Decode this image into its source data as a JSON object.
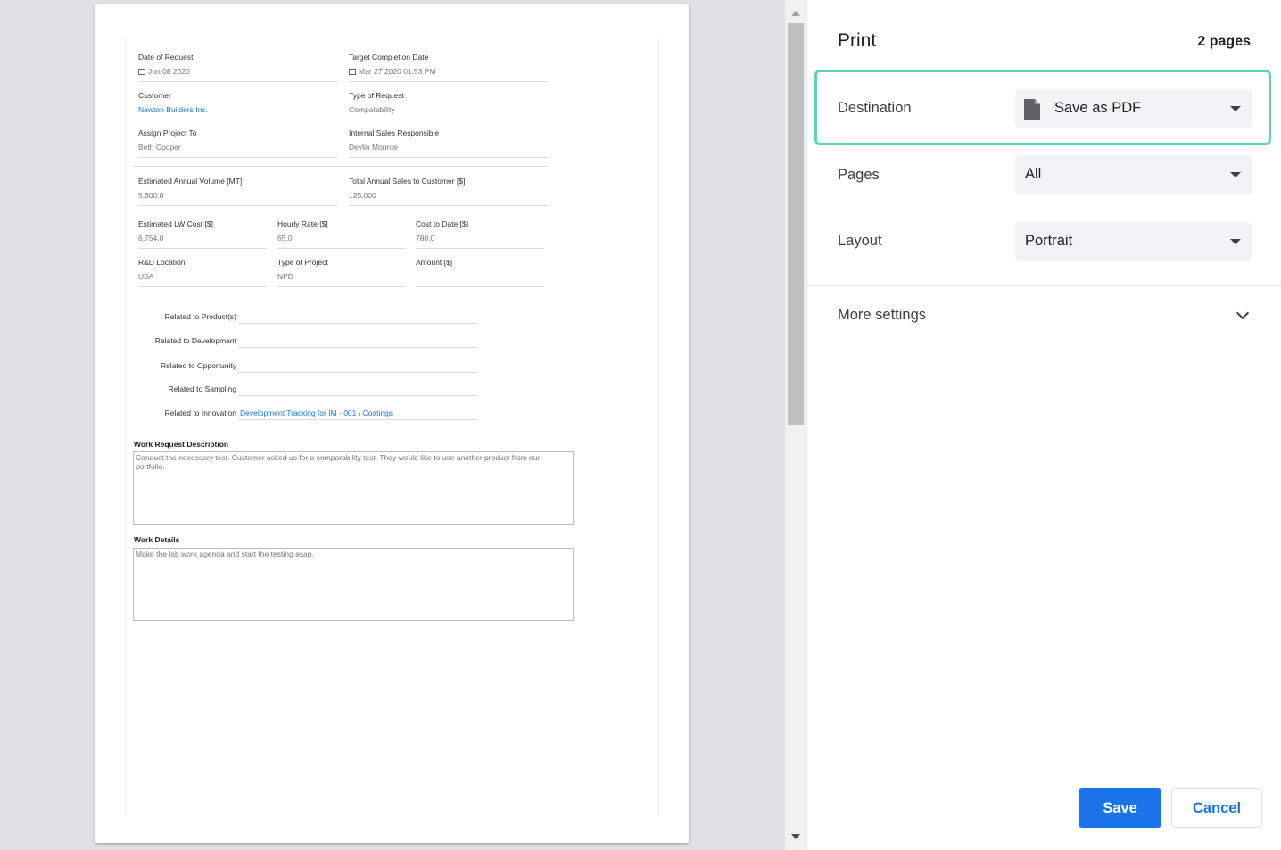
{
  "document": {
    "fields": {
      "date_of_request": {
        "label": "Date of Request",
        "value": "Jun 08 2020"
      },
      "target_completion": {
        "label": "Target Completion Date",
        "value": "Mar 27 2020 01:53 PM"
      },
      "customer": {
        "label": "Customer",
        "value": "Newton Builders Inc."
      },
      "type_of_request": {
        "label": "Type of Request",
        "value": "Compatability"
      },
      "assign_project_to": {
        "label": "Assign Project To",
        "value": "Beth Cooper"
      },
      "internal_sales": {
        "label": "Internal Sales Responsible",
        "value": "Devlin Monroe"
      },
      "est_annual_volume": {
        "label": "Estimated Annual Volume [MT]",
        "value": "5,600.0"
      },
      "total_annual_sales": {
        "label": "Total Annual Sales to Customer [$]",
        "value": "125,000"
      },
      "est_lw_cost": {
        "label": "Estimated LW Cost [$]",
        "value": "6,754.0"
      },
      "hourly_rate": {
        "label": "Hourly Rate [$]",
        "value": "65.0"
      },
      "cost_to_date": {
        "label": "Cost to Date [$]",
        "value": "780.0"
      },
      "rd_location": {
        "label": "R&D Location",
        "value": "USA"
      },
      "type_of_project": {
        "label": "Type of Project",
        "value": "NPD"
      },
      "amount": {
        "label": "Amount [$]",
        "value": ""
      }
    },
    "related": [
      {
        "label": "Related to Product(s)",
        "value": ""
      },
      {
        "label": "Related to Development",
        "value": ""
      },
      {
        "label": "Related to Opportunity",
        "value": ""
      },
      {
        "label": "Related to Sampling",
        "value": ""
      },
      {
        "label": "Related to Innovation",
        "value": "Development Tracking for IM - 001 / Coatings"
      }
    ],
    "work_request": {
      "title": "Work Request Description",
      "text": "Conduct the necessary test. Customer asked us for a comparability test. They would like to use another product from our portfolio."
    },
    "work_details": {
      "title": "Work Details",
      "text": "Make the lab work agenda and start the testing asap."
    }
  },
  "print_panel": {
    "title": "Print",
    "page_count": "2 pages",
    "destination": {
      "label": "Destination",
      "value": "Save as PDF"
    },
    "pages": {
      "label": "Pages",
      "value": "All"
    },
    "layout": {
      "label": "Layout",
      "value": "Portrait"
    },
    "more_settings": "More settings",
    "save_label": "Save",
    "cancel_label": "Cancel"
  },
  "colors": {
    "accent": "#1a73e8",
    "highlight": "#5fd3b3",
    "preview_bg": "#dee1e6"
  },
  "icons": [
    "calendar-icon",
    "pdf-file-icon",
    "caret-down-icon",
    "chevron-down-icon",
    "scroll-up-arrow-icon",
    "scroll-down-arrow-icon"
  ]
}
